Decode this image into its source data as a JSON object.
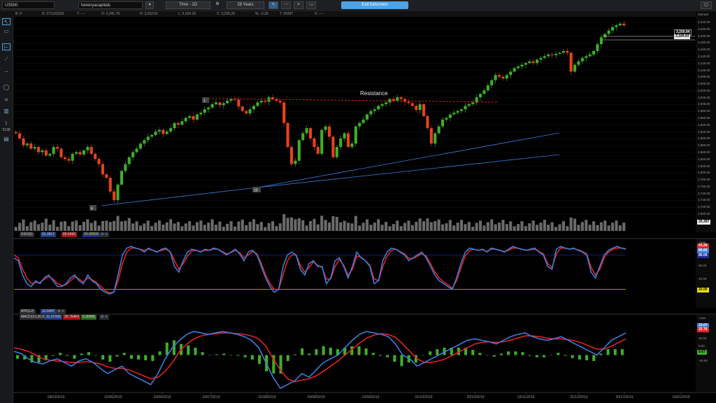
{
  "toolbar": {
    "symbol": "US500",
    "account": "herenyacapitals",
    "timeframe": "Time - 1D",
    "range": "28 Years",
    "exit_label": "Exit fullscreen"
  },
  "infobar": {
    "b": "B: 0",
    "date": "D: 27/12/2019",
    "t": "T: ----",
    "o": "O: 3,241.76",
    "h": "H: 3,252.51",
    "l": "L: 3,234.16",
    "c": "C: 3,235.26",
    "pct": "%: -0.26",
    "ticks": "T: 20397",
    "v": "V: ----"
  },
  "price_axis": {
    "mode": "Manual",
    "ticks": [
      "3,240.00",
      "3,220.00",
      "3,200.00",
      "3,180.00",
      "3,160.00",
      "3,140.00",
      "3,120.00",
      "3,100.00",
      "3,085.00",
      "3,065.00",
      "3,045.00",
      "3,025.00",
      "3,005.00",
      "2,980.00",
      "2,960.00",
      "2,940.00",
      "2,920.00",
      "2,900.00",
      "2,880.00",
      "2,860.00",
      "2,840.00",
      "2,820.00",
      "2,800.00",
      "2,780.00",
      "2,760.00",
      "2,740.00",
      "2,720.00",
      "2,700.00",
      "2,680.00"
    ],
    "tag_high": "3,200.94",
    "tag_low": "3,189.83",
    "tag_bottom": "20,397"
  },
  "stoch_axis": {
    "mode": "Auto",
    "tag_k": "91.28",
    "tag_d": "89.65",
    "tag_80": "80.00",
    "tick_60": "60.00",
    "tick_40": "40.00",
    "tag_20": "20.00"
  },
  "macd_axis": {
    "mode": "Auto",
    "tag_1": "31.07",
    "tag_2": "25.76",
    "tick_20": "20.00",
    "tick_0": "0.00",
    "tag_hist": "5.67",
    "tick_m20": "-20.00"
  },
  "indicators": {
    "stoch": "SSO(5)",
    "stoch_k": "91.2817",
    "stoch_d": "89.6496",
    "stoch_level": "20.00000",
    "atr": "ATR(12)",
    "atr_val": "31.6447",
    "macd": "MACD(12,26,9)",
    "macd_1": "31.07155",
    "macd_2": "25.76460",
    "macd_3": "5.30695"
  },
  "annotations": {
    "resistance": "Resistance",
    "low_6": "6",
    "low_10": "10",
    "high_1": "1",
    "left_label": "5138"
  },
  "x_axis_labels": [
    "18/03/2019",
    "02/06/2019",
    "20/06/2019",
    "10/07/2019",
    "01/08/2019",
    "20/08/2019",
    "10/09/2019",
    "01/10/2019",
    "20/10/2019",
    "10/11/2019",
    "01/12/2019",
    "20/12/2019",
    "10/01/2020"
  ],
  "colors": {
    "up": "#3fae2a",
    "down": "#e8411d",
    "blue": "#3b7ddd",
    "red": "#e22222",
    "bg": "#000000"
  },
  "chart_data": {
    "type": "candlestick",
    "ylim": [
      2680,
      3260
    ],
    "close": [
      2920,
      2905,
      2885,
      2890,
      2875,
      2880,
      2865,
      2870,
      2855,
      2860,
      2880,
      2875,
      2850,
      2845,
      2840,
      2860,
      2865,
      2858,
      2870,
      2880,
      2860,
      2845,
      2830,
      2800,
      2790,
      2750,
      2725,
      2770,
      2810,
      2830,
      2850,
      2865,
      2875,
      2890,
      2900,
      2910,
      2915,
      2925,
      2930,
      2918,
      2925,
      2935,
      2950,
      2945,
      2955,
      2965,
      2970,
      2960,
      2975,
      2980,
      2990,
      2995,
      3005,
      3010,
      3002,
      3008,
      3015,
      3020,
      3018,
      2998,
      2985,
      2978,
      2990,
      3000,
      3010,
      3015,
      3012,
      3025,
      3020,
      3015,
      3010,
      2950,
      2880,
      2830,
      2840,
      2900,
      2920,
      2935,
      2905,
      2880,
      2860,
      2930,
      2940,
      2910,
      2850,
      2880,
      2905,
      2920,
      2880,
      2890,
      2940,
      2950,
      2960,
      2975,
      2985,
      2990,
      3000,
      3005,
      3010,
      3020,
      3015,
      3025,
      3020,
      3012,
      3008,
      3000,
      2988,
      3005,
      2970,
      2935,
      2890,
      2920,
      2940,
      2960,
      2965,
      2975,
      2980,
      2985,
      2990,
      3000,
      3005,
      3010,
      3025,
      3035,
      3045,
      3060,
      3075,
      3090,
      3085,
      3080,
      3090,
      3100,
      3110,
      3115,
      3120,
      3125,
      3130,
      3125,
      3135,
      3140,
      3145,
      3150,
      3148,
      3152,
      3155,
      3160,
      3155,
      3100,
      3120,
      3130,
      3140,
      3145,
      3150,
      3160,
      3180,
      3200,
      3210,
      3220,
      3230,
      3235,
      3240,
      3235
    ],
    "stoch_k": [
      75,
      70,
      45,
      30,
      25,
      35,
      30,
      40,
      45,
      35,
      25,
      25,
      30,
      40,
      45,
      35,
      30,
      45,
      35,
      30,
      20,
      15,
      12,
      15,
      45,
      80,
      92,
      95,
      92,
      90,
      85,
      92,
      88,
      85,
      90,
      92,
      85,
      60,
      50,
      70,
      85,
      90,
      88,
      85,
      90,
      88,
      92,
      90,
      85,
      80,
      85,
      90,
      82,
      70,
      85,
      88,
      80,
      60,
      40,
      25,
      15,
      20,
      60,
      80,
      85,
      80,
      55,
      45,
      65,
      70,
      60,
      60,
      30,
      40,
      70,
      75,
      60,
      40,
      60,
      85,
      75,
      70,
      60,
      30,
      35,
      70,
      85,
      92,
      90,
      85,
      80,
      70,
      75,
      80,
      85,
      75,
      60,
      45,
      35,
      30,
      25,
      20,
      40,
      65,
      85,
      92,
      90,
      88,
      90,
      85,
      92,
      90,
      88,
      85,
      90,
      95,
      92,
      90,
      88,
      90,
      92,
      85,
      80,
      60,
      55,
      90,
      95,
      92,
      90,
      92,
      88,
      85,
      80,
      50,
      40,
      60,
      80,
      88,
      92,
      95,
      92,
      90
    ],
    "stoch_d": [
      80,
      75,
      55,
      40,
      30,
      32,
      32,
      38,
      42,
      38,
      30,
      27,
      28,
      35,
      42,
      38,
      33,
      40,
      37,
      32,
      25,
      18,
      14,
      15,
      35,
      65,
      85,
      92,
      92,
      90,
      88,
      90,
      88,
      86,
      88,
      90,
      86,
      70,
      55,
      65,
      78,
      87,
      88,
      86,
      88,
      88,
      90,
      90,
      86,
      82,
      84,
      88,
      84,
      75,
      80,
      86,
      82,
      65,
      45,
      30,
      20,
      20,
      45,
      70,
      80,
      80,
      62,
      50,
      58,
      68,
      62,
      58,
      38,
      38,
      60,
      72,
      62,
      45,
      55,
      78,
      76,
      70,
      62,
      38,
      35,
      60,
      78,
      88,
      90,
      86,
      82,
      74,
      74,
      78,
      82,
      78,
      65,
      50,
      40,
      33,
      28,
      22,
      35,
      58,
      78,
      88,
      90,
      88,
      89,
      86,
      90,
      90,
      88,
      86,
      88,
      92,
      92,
      90,
      88,
      89,
      90,
      86,
      82,
      65,
      58,
      82,
      92,
      92,
      90,
      91,
      89,
      86,
      82,
      58,
      45,
      55,
      75,
      85,
      90,
      92,
      92,
      91
    ],
    "macd_line": [
      5,
      2,
      -5,
      -10,
      -12,
      -8,
      -5,
      -10,
      -15,
      -8,
      -5,
      -10,
      -18,
      -25,
      -20,
      -15,
      -25,
      -30,
      -35,
      -40,
      -25,
      -5,
      10,
      20,
      28,
      32,
      30,
      28,
      30,
      32,
      30,
      28,
      25,
      20,
      10,
      -10,
      -30,
      -45,
      -40,
      -35,
      -25,
      -30,
      -20,
      -10,
      -5,
      0,
      10,
      20,
      28,
      32,
      30,
      28,
      25,
      15,
      0,
      -5,
      -15,
      -10,
      -5,
      0,
      5,
      10,
      15,
      20,
      22,
      20,
      18,
      15,
      20,
      25,
      28,
      30,
      25,
      22,
      20,
      22,
      25,
      20,
      15,
      10,
      5,
      0,
      10,
      20,
      25,
      30
    ],
    "signal_line": [
      10,
      8,
      5,
      0,
      -5,
      -7,
      -8,
      -9,
      -10,
      -10,
      -9,
      -10,
      -12,
      -16,
      -18,
      -18,
      -20,
      -24,
      -28,
      -32,
      -30,
      -22,
      -10,
      5,
      15,
      22,
      26,
      28,
      29,
      30,
      30,
      29,
      28,
      26,
      22,
      12,
      -5,
      -20,
      -32,
      -36,
      -34,
      -32,
      -28,
      -22,
      -15,
      -8,
      0,
      8,
      16,
      23,
      27,
      29,
      28,
      24,
      15,
      5,
      -5,
      -10,
      -10,
      -8,
      -5,
      0,
      5,
      10,
      15,
      17,
      18,
      17,
      18,
      20,
      23,
      26,
      26,
      25,
      23,
      22,
      22,
      21,
      19,
      16,
      12,
      8,
      8,
      12,
      17,
      22
    ],
    "macd_hist": [
      -5,
      -6,
      -10,
      -10,
      -7,
      -1,
      3,
      -1,
      -5,
      2,
      4,
      0,
      -6,
      -9,
      -2,
      3,
      -5,
      -6,
      -7,
      -8,
      5,
      17,
      20,
      15,
      13,
      10,
      4,
      0,
      1,
      2,
      0,
      -1,
      -3,
      -6,
      -12,
      -22,
      -25,
      -25,
      -8,
      1,
      9,
      2,
      8,
      12,
      10,
      8,
      10,
      12,
      12,
      9,
      3,
      -1,
      -3,
      -9,
      -15,
      -10,
      -10,
      0,
      5,
      8,
      10,
      10,
      10,
      10,
      7,
      3,
      0,
      -2,
      2,
      5,
      5,
      4,
      -1,
      -3,
      -3,
      0,
      3,
      -1,
      -4,
      -6,
      -7,
      -8,
      2,
      8,
      8,
      8
    ]
  }
}
